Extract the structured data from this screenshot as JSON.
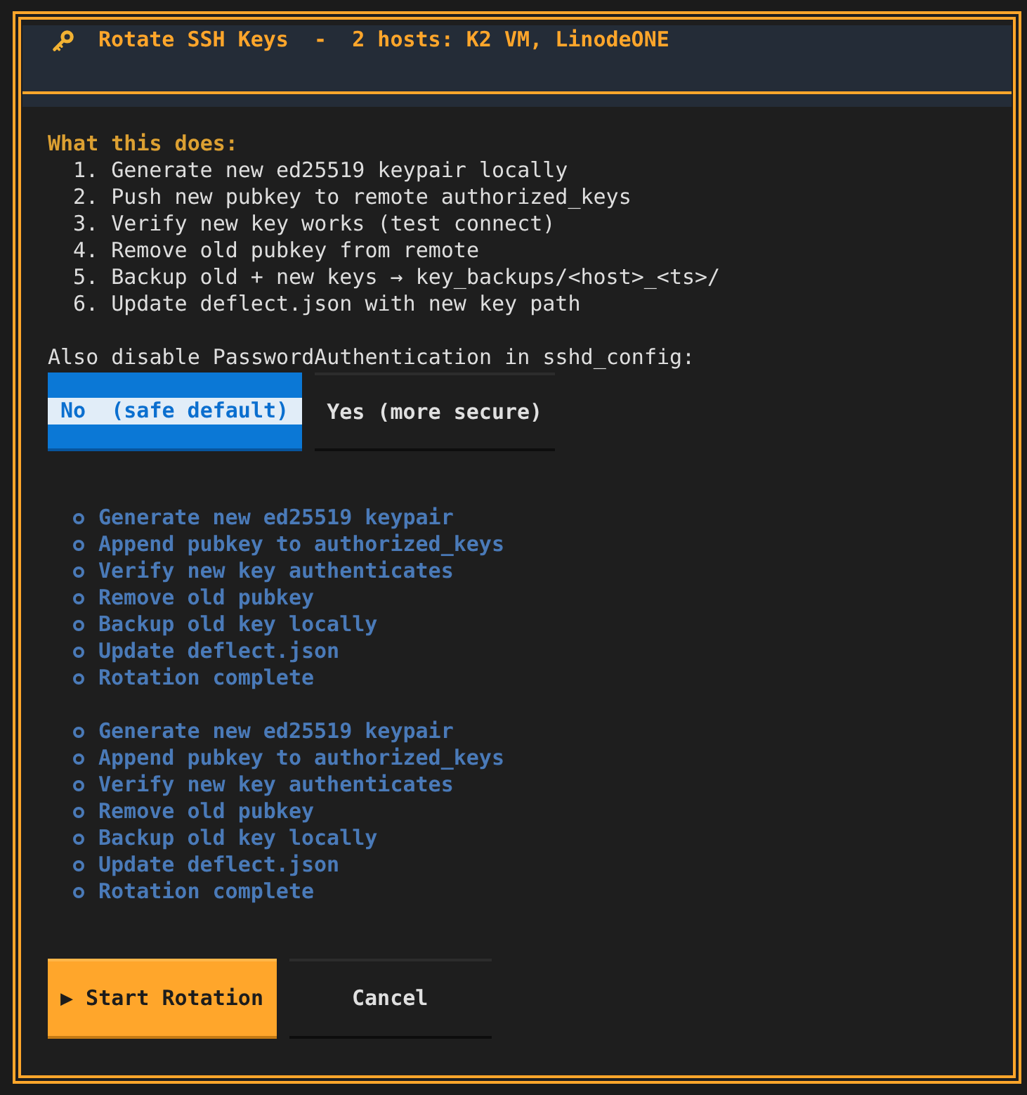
{
  "dialog": {
    "title": "Rotate SSH Keys  -  2 hosts: K2 VM, LinodeONE"
  },
  "summary": {
    "heading": "What this does:",
    "steps": [
      "1. Generate new ed25519 keypair locally",
      "2. Push new pubkey to remote authorized_keys",
      "3. Verify new key works (test connect)",
      "4. Remove old pubkey from remote",
      "5. Backup old + new keys → key_backups/<host>_<ts>/",
      "6. Update deflect.json with new key path"
    ]
  },
  "password_auth": {
    "label": "Also disable PasswordAuthentication in sshd_config:",
    "options": [
      {
        "label": "No  (safe default)",
        "selected": true
      },
      {
        "label": "Yes (more secure)",
        "selected": false
      }
    ]
  },
  "progress": [
    {
      "steps": [
        {
          "label": "Generate new ed25519 keypair",
          "done": false
        },
        {
          "label": "Append pubkey to authorized_keys",
          "done": false
        },
        {
          "label": "Verify new key authenticates",
          "done": false
        },
        {
          "label": "Remove old pubkey",
          "done": false
        },
        {
          "label": "Backup old key locally",
          "done": false
        },
        {
          "label": "Update deflect.json",
          "done": false
        },
        {
          "label": "Rotation complete",
          "done": false
        }
      ]
    },
    {
      "steps": [
        {
          "label": "Generate new ed25519 keypair",
          "done": false
        },
        {
          "label": "Append pubkey to authorized_keys",
          "done": false
        },
        {
          "label": "Verify new key authenticates",
          "done": false
        },
        {
          "label": "Remove old pubkey",
          "done": false
        },
        {
          "label": "Backup old key locally",
          "done": false
        },
        {
          "label": "Update deflect.json",
          "done": false
        },
        {
          "label": "Rotation complete",
          "done": false
        }
      ]
    }
  ],
  "buttons": [
    {
      "label": "▶ Start Rotation",
      "kind": "primary"
    },
    {
      "label": "Cancel",
      "kind": "default"
    }
  ]
}
